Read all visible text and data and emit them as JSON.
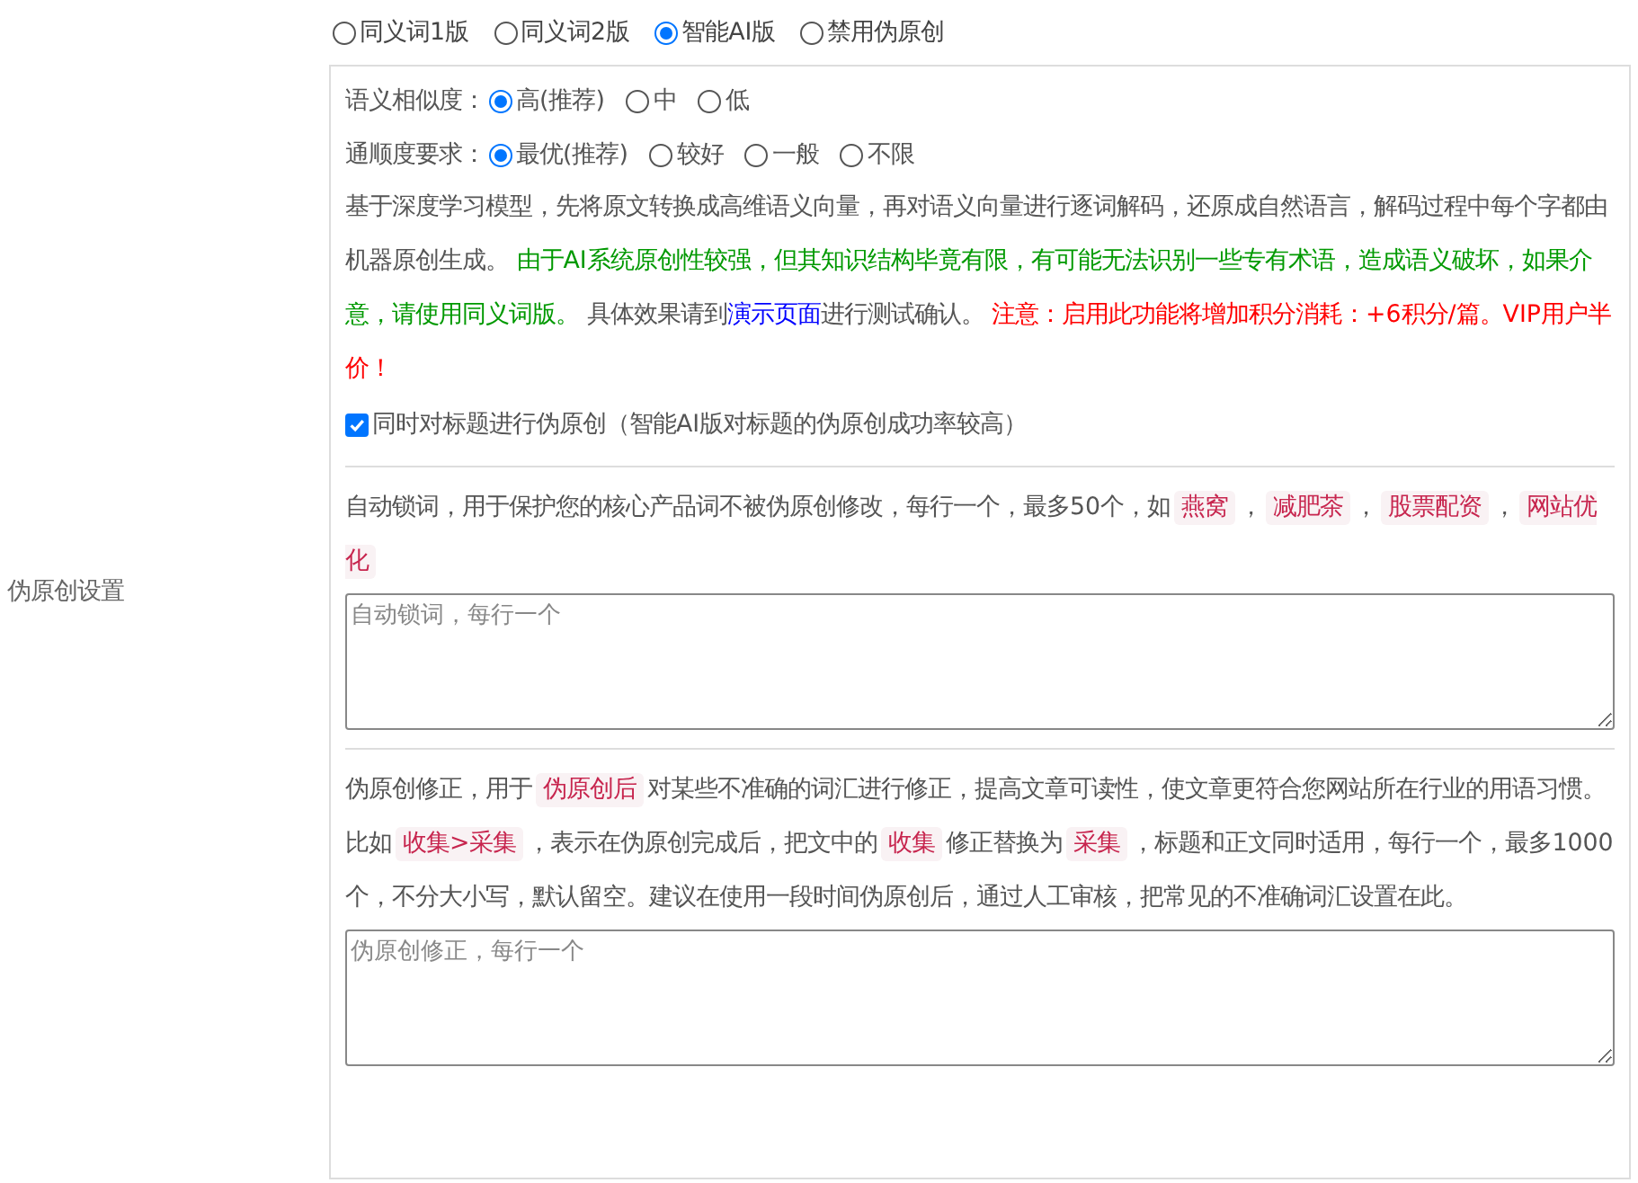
{
  "section_label": "伪原创设置",
  "modes": [
    {
      "label": "同义词1版",
      "selected": false
    },
    {
      "label": "同义词2版",
      "selected": false
    },
    {
      "label": "智能AI版",
      "selected": true
    },
    {
      "label": "禁用伪原创",
      "selected": false
    }
  ],
  "settings": [
    {
      "label": "语义相似度：",
      "options": [
        {
          "label": "高(推荐)",
          "selected": true
        },
        {
          "label": "中",
          "selected": false
        },
        {
          "label": "低",
          "selected": false
        }
      ]
    },
    {
      "label": "通顺度要求：",
      "options": [
        {
          "label": "最优(推荐)",
          "selected": true
        },
        {
          "label": "较好",
          "selected": false
        },
        {
          "label": "一般",
          "selected": false
        },
        {
          "label": "不限",
          "selected": false
        }
      ]
    }
  ],
  "description": [
    {
      "kind": "text",
      "text": "基于深度学习模型，先将原文转换成高维语义向量，再对语义向量进行逐词解码，还原成自然语言，解码过程中每个字都由机器原创生成。 "
    },
    {
      "kind": "notice",
      "text": "由于AI系统原创性较强，但其知识结构毕竟有限，有可能无法识别一些专有术语，造成语义破坏，如果介意，请使用同义词版。"
    },
    {
      "kind": "text",
      "text": " 具体效果请到"
    },
    {
      "kind": "link",
      "text": "演示页面"
    },
    {
      "kind": "text",
      "text": "进行测试确认。 "
    },
    {
      "kind": "warning",
      "text": "注意：启用此功能将增加积分消耗：+6积分/篇。VIP用户半价！"
    }
  ],
  "title_option": {
    "label": "同时对标题进行伪原创（智能AI版对标题的伪原创成功率较高）",
    "checked": true
  },
  "lock_words": {
    "segments": [
      {
        "kind": "text",
        "text": "自动锁词，用于保护您的核心产品词不被伪原创修改，每行一个，最多50个，如"
      },
      {
        "kind": "tag",
        "text": "燕窝"
      },
      {
        "kind": "text",
        "text": "，"
      },
      {
        "kind": "tag",
        "text": "减肥茶"
      },
      {
        "kind": "text",
        "text": "，"
      },
      {
        "kind": "tag",
        "text": "股票配资"
      },
      {
        "kind": "text",
        "text": "，"
      },
      {
        "kind": "tag",
        "text": "网站优化"
      }
    ],
    "placeholder": "自动锁词，每行一个"
  },
  "corrections": {
    "segments": [
      {
        "kind": "text",
        "text": "伪原创修正，用于"
      },
      {
        "kind": "tag",
        "text": "伪原创后"
      },
      {
        "kind": "text",
        "text": "对某些不准确的词汇进行修正，提高文章可读性，使文章更符合您网站所在行业的用语习惯。比如"
      },
      {
        "kind": "tag",
        "text": "收集>采集"
      },
      {
        "kind": "text",
        "text": "，表示在伪原创完成后，把文中的"
      },
      {
        "kind": "tag",
        "text": "收集"
      },
      {
        "kind": "text",
        "text": "修正替换为"
      },
      {
        "kind": "tag",
        "text": "采集"
      },
      {
        "kind": "text",
        "text": "，标题和正文同时适用，每行一个，最多1000个，不分大小写，默认留空。建议在使用一段时间伪原创后，通过人工审核，把常见的不准确词汇设置在此。"
      }
    ],
    "placeholder": "伪原创修正，每行一个"
  }
}
